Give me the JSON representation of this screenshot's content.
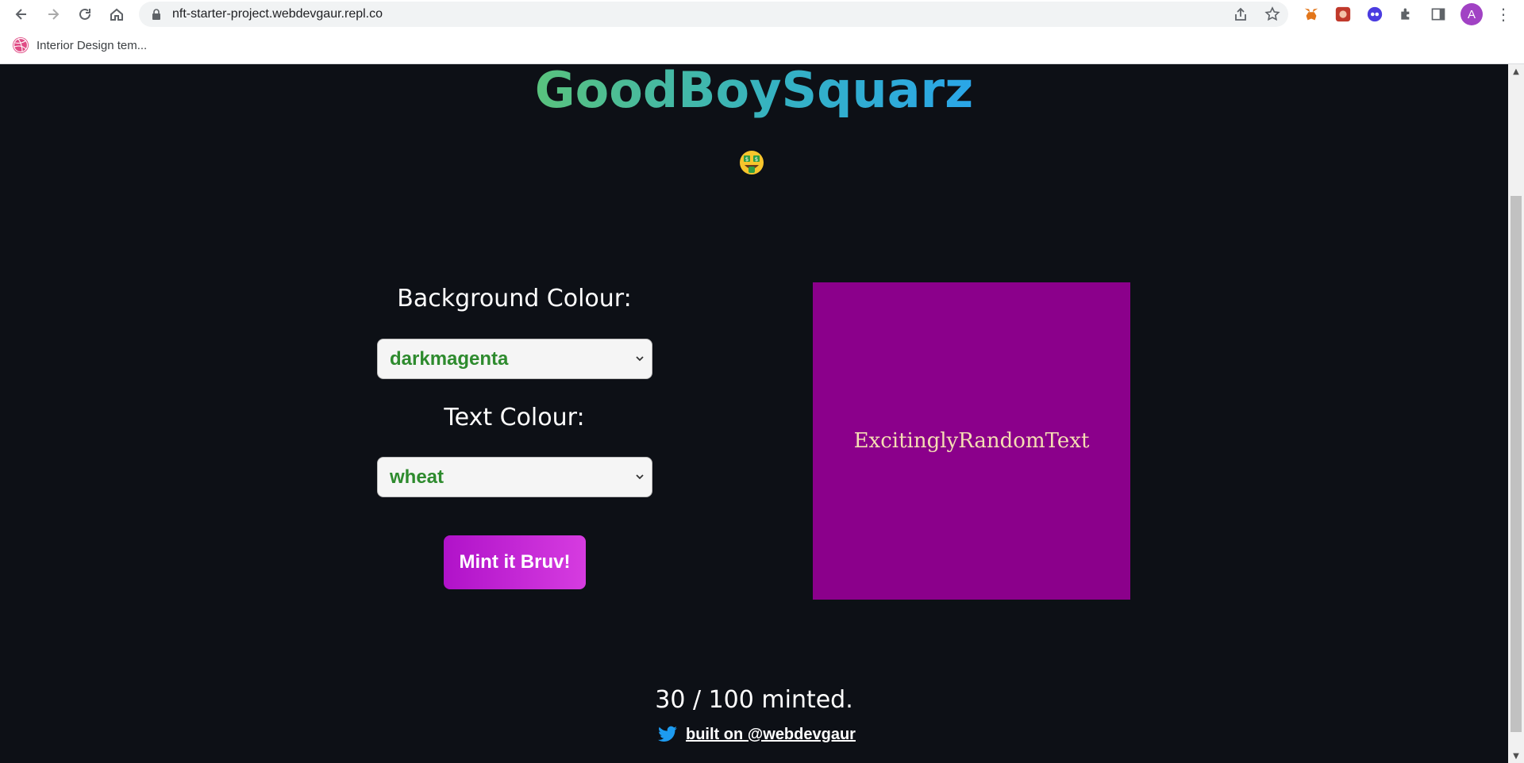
{
  "browser": {
    "url": "nft-starter-project.webdevgaur.repl.co",
    "avatar_initial": "A",
    "bookmark_label": "Interior Design tem..."
  },
  "page": {
    "title": "GoodBoySquarz",
    "background_label": "Background Colour:",
    "background_value": "darkmagenta",
    "text_label": "Text Colour:",
    "text_value": "wheat",
    "mint_button": "Mint it Bruv!",
    "nft_text": "ExcitinglyRandomText",
    "minted_status": "30 / 100 minted.",
    "footer_link": "built on @webdevgaur"
  },
  "colors": {
    "page_bg": "#0d1016",
    "nft_bg": "#8b008b",
    "nft_text": "#f5deb3",
    "select_text": "#2e8b2e",
    "mint_gradient_start": "#b012c9",
    "mint_gradient_end": "#d63ce0",
    "title_gradient_start": "#59c27d",
    "title_gradient_end": "#2aa6e8"
  },
  "icons": {
    "emoji": "money-mouth-face-icon",
    "footer": "twitter-bird-icon"
  }
}
